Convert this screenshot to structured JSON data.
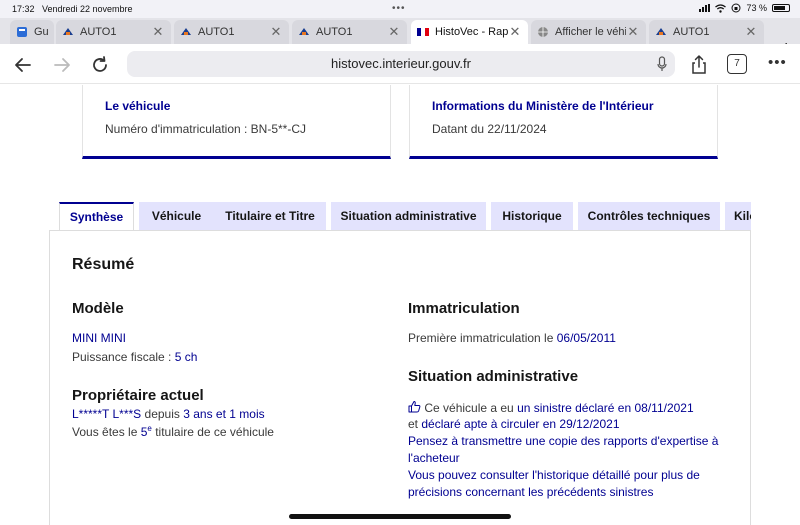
{
  "status": {
    "time": "17:32",
    "date": "Vendredi 22 novembre",
    "battery": "73 %"
  },
  "tabs": [
    {
      "title": "Guide",
      "favicon": "guide-icon"
    },
    {
      "title": "AUTO1",
      "favicon": "auto1-icon"
    },
    {
      "title": "AUTO1",
      "favicon": "auto1-icon"
    },
    {
      "title": "AUTO1",
      "favicon": "auto1-icon"
    },
    {
      "title": "HistoVec - Rapport",
      "favicon": "french-flag-icon",
      "active": true
    },
    {
      "title": "Afficher le véhicule",
      "favicon": "globe-icon"
    },
    {
      "title": "AUTO1",
      "favicon": "auto1-icon"
    }
  ],
  "url": "histovec.interieur.gouv.fr",
  "tab_count": "7",
  "cards": {
    "vehicle": {
      "title": "Le véhicule",
      "text": "Numéro d'immatriculation : BN-5**-CJ"
    },
    "ministry": {
      "title": "Informations du Ministère de l'Intérieur",
      "text": "Datant du 22/11/2024"
    }
  },
  "report_tabs": [
    "Synthèse",
    "Véhicule",
    "Titulaire et Titre",
    "Situation administrative",
    "Historique",
    "Contrôles techniques",
    "Kilo"
  ],
  "summary": {
    "title": "Résumé",
    "model_heading": "Modèle",
    "model_value": "MINI MINI",
    "fiscal_label": "Puissance fiscale :",
    "fiscal_value": "5 ch",
    "owner_heading": "Propriétaire actuel",
    "owner_name": "L*****T L***S",
    "owner_since_label": "depuis",
    "owner_since_value": "3 ans et 1 mois",
    "owner_rank_prefix": "Vous êtes le",
    "owner_rank": "5",
    "owner_rank_sup": "e",
    "owner_rank_suffix": "titulaire de ce véhicule",
    "registration_heading": "Immatriculation",
    "first_reg_label": "Première immatriculation le",
    "first_reg_date": "06/05/2011",
    "admin_heading": "Situation administrative",
    "admin_line1_prefix": "Ce véhicule a eu",
    "admin_line1_link": "un sinistre déclaré en 08/11/2021",
    "admin_line2_prefix": "et",
    "admin_line2_link": "déclaré apte à circuler en 29/12/2021",
    "admin_line3": "Pensez à transmettre une copie des rapports d'expertise à",
    "admin_line4": "l'acheteur",
    "admin_line5": "Vous pouvez consulter l'historique détaillé pour plus de",
    "admin_line6": "précisions concernant les précédents sinistres"
  }
}
